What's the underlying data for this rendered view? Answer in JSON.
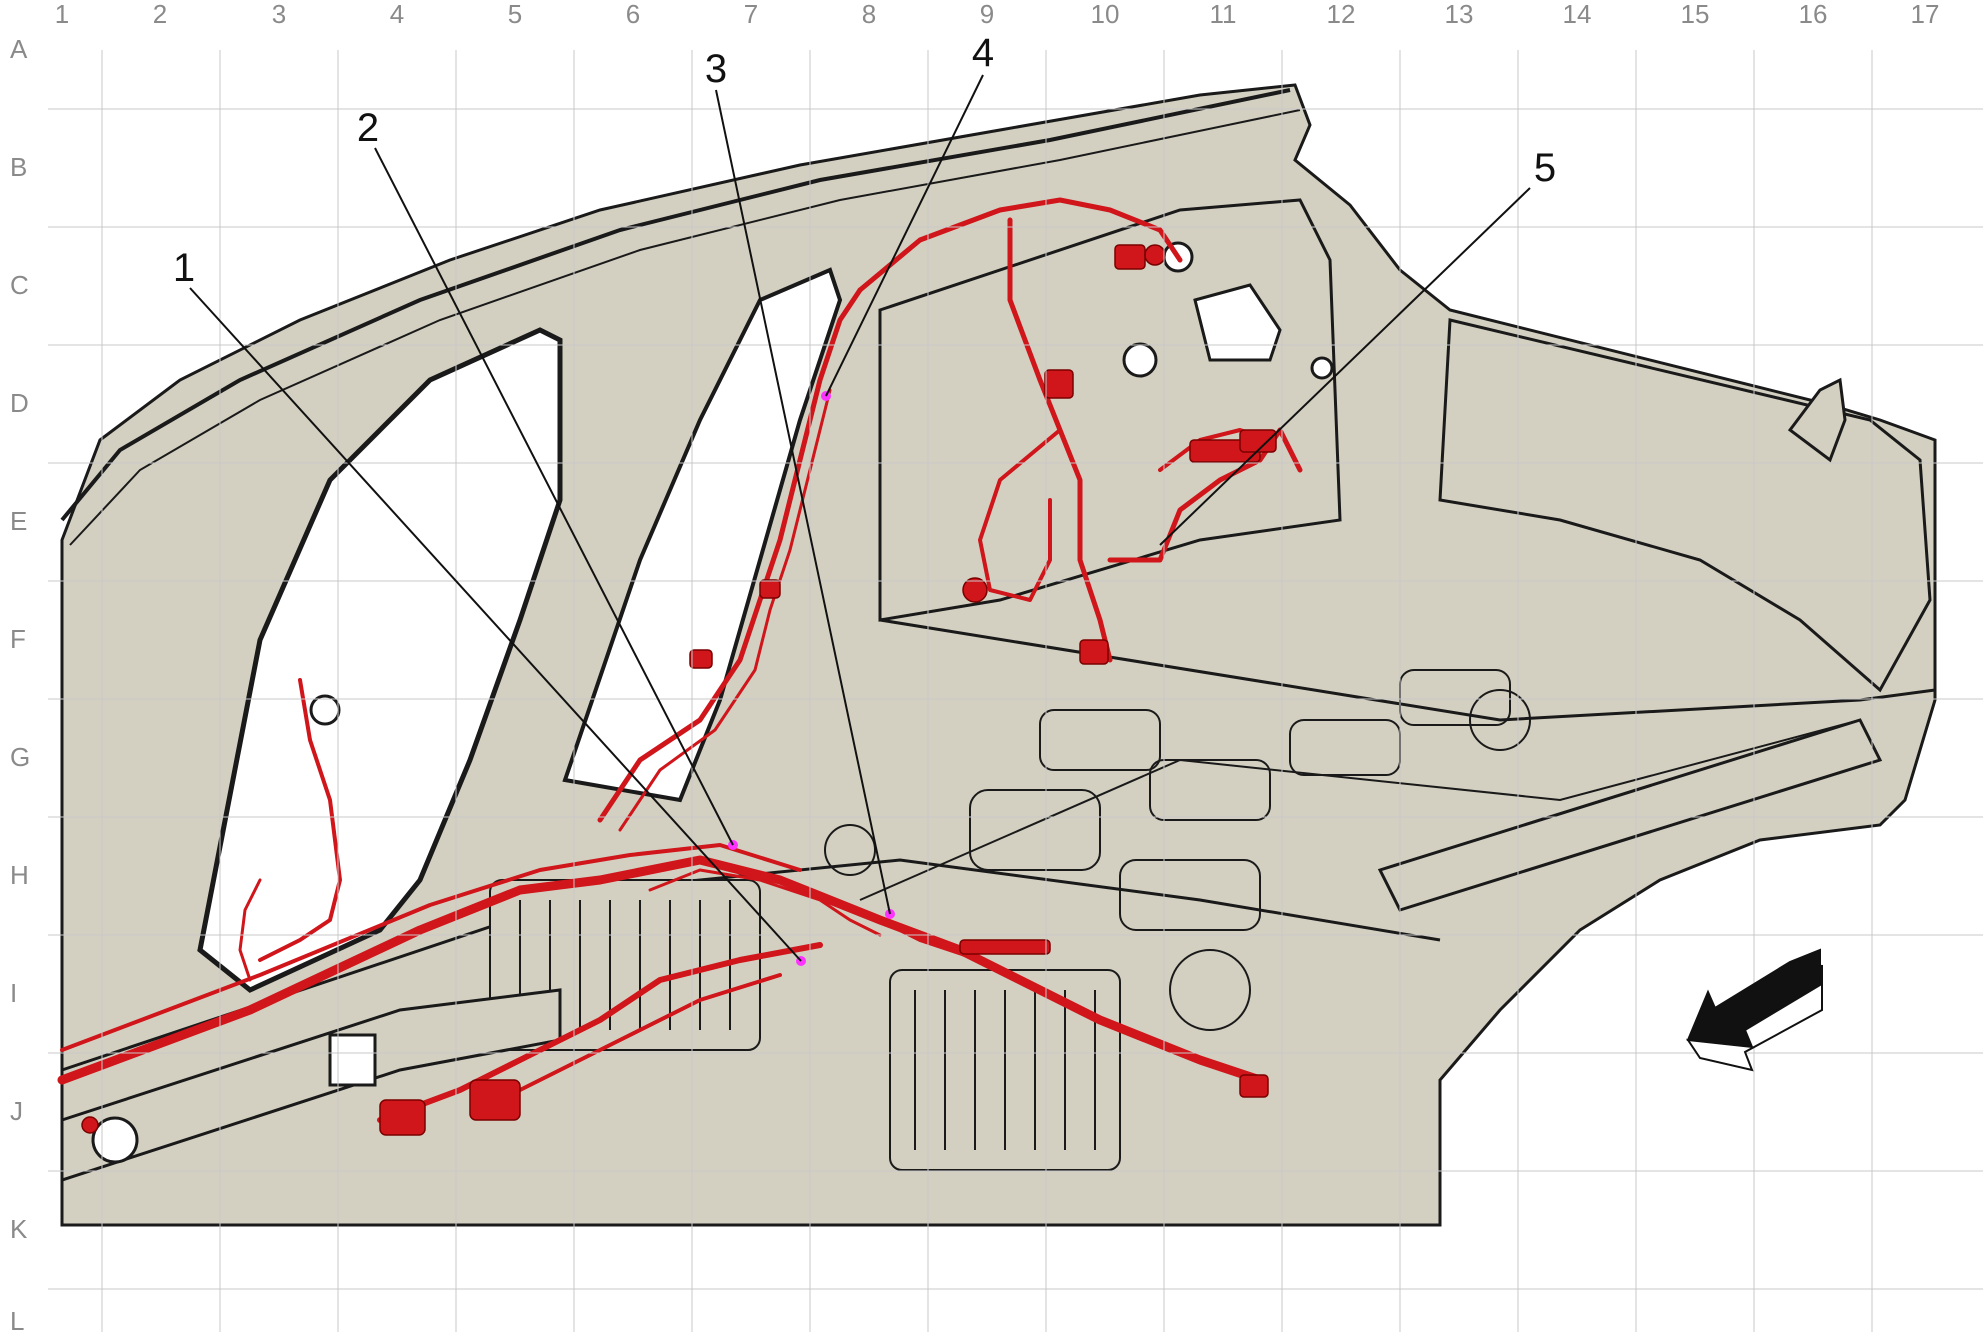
{
  "grid": {
    "columns": [
      "1",
      "2",
      "3",
      "4",
      "5",
      "6",
      "7",
      "8",
      "9",
      "10",
      "11",
      "12",
      "13",
      "14",
      "15",
      "16",
      "17"
    ],
    "rows": [
      "A",
      "B",
      "C",
      "D",
      "E",
      "F",
      "G",
      "H",
      "I",
      "J",
      "K",
      "L"
    ]
  },
  "callouts": [
    {
      "label": "1"
    },
    {
      "label": "2"
    },
    {
      "label": "3"
    },
    {
      "label": "4"
    },
    {
      "label": "5"
    }
  ],
  "colors": {
    "body_fill": "#d3d0c1",
    "outline": "#1a1a1a",
    "harness": "#d0151b",
    "connector_marker": "#ff33ff",
    "grid_line": "#c8c8c8",
    "grid_label": "#8a8a8a"
  },
  "icons": {
    "direction_arrow": "front-direction-arrow-icon"
  }
}
